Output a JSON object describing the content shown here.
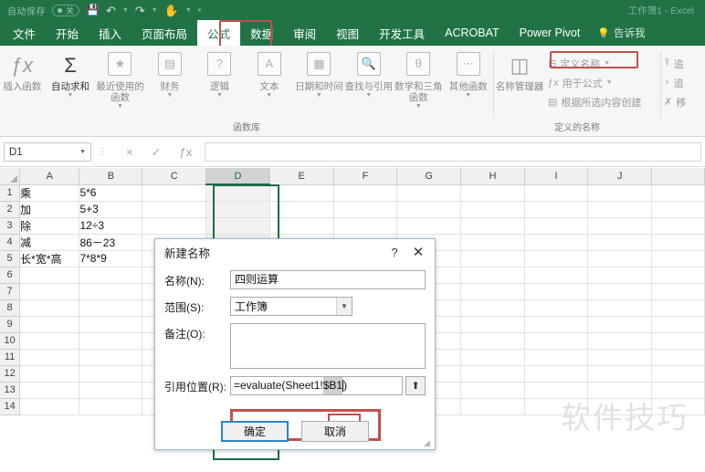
{
  "titlebar": {
    "autosave_label": "自动保存",
    "autosave_state": "关",
    "save_icon": "save-icon",
    "undo_icon": "undo-icon",
    "redo_icon": "redo-icon",
    "touch_icon": "touch-mode-icon",
    "customize_icon": "customize-qat-icon",
    "document_title": "工作簿1  -  Excel"
  },
  "tabs": [
    {
      "label": "文件",
      "active": false
    },
    {
      "label": "开始",
      "active": false
    },
    {
      "label": "插入",
      "active": false
    },
    {
      "label": "页面布局",
      "active": false
    },
    {
      "label": "公式",
      "active": true
    },
    {
      "label": "数据",
      "active": false
    },
    {
      "label": "审阅",
      "active": false
    },
    {
      "label": "视图",
      "active": false
    },
    {
      "label": "开发工具",
      "active": false
    },
    {
      "label": "ACROBAT",
      "active": false
    },
    {
      "label": "Power Pivot",
      "active": false
    }
  ],
  "tellme": {
    "icon": "lightbulb-icon",
    "label": "告诉我"
  },
  "ribbon": {
    "groups": [
      {
        "label": "函数库",
        "buttons": [
          {
            "glyph": "ƒx",
            "label": "插入函数",
            "dark": false,
            "caret": false,
            "name": "insert-function-button"
          },
          {
            "glyph": "Σ",
            "label": "自动求和",
            "dark": true,
            "caret": true,
            "name": "autosum-button"
          },
          {
            "glyph": "★",
            "label": "最近使用的函数",
            "dark": false,
            "caret": true,
            "name": "recently-used-button"
          },
          {
            "glyph": "☷",
            "label": "财务",
            "dark": false,
            "caret": true,
            "name": "financial-button"
          },
          {
            "glyph": "?",
            "label": "逻辑",
            "dark": false,
            "caret": true,
            "name": "logical-button"
          },
          {
            "glyph": "A",
            "label": "文本",
            "dark": false,
            "caret": true,
            "name": "text-button"
          },
          {
            "glyph": "▦",
            "label": "日期和时间",
            "dark": false,
            "caret": true,
            "name": "date-time-button"
          },
          {
            "glyph": "◎",
            "label": "查找与引用",
            "dark": false,
            "caret": true,
            "name": "lookup-reference-button"
          },
          {
            "glyph": "θ",
            "label": "数学和三角函数",
            "dark": false,
            "caret": true,
            "name": "math-trig-button"
          },
          {
            "glyph": "⋯",
            "label": "其他函数",
            "dark": false,
            "caret": true,
            "name": "more-functions-button"
          }
        ]
      },
      {
        "label": "定义的名称",
        "big": {
          "glyph": "☰",
          "label": "名称管理器",
          "name": "name-manager-button"
        },
        "small": [
          {
            "icon": "⊟",
            "label": "定义名称",
            "caret": true,
            "highlighted": true,
            "name": "define-name-button"
          },
          {
            "icon": "ƒx",
            "label": "用于公式",
            "caret": true,
            "highlighted": false,
            "name": "use-in-formula-button"
          },
          {
            "icon": "▤",
            "label": "根据所选内容创建",
            "caret": false,
            "highlighted": false,
            "name": "create-from-selection-button"
          }
        ]
      },
      {
        "label": "",
        "small": [
          {
            "icon": "⑂",
            "label": "追",
            "caret": false,
            "highlighted": false,
            "name": "trace-precedents-button"
          },
          {
            "icon": "⑆",
            "label": "追",
            "caret": false,
            "highlighted": false,
            "name": "trace-dependents-button"
          },
          {
            "icon": "✗",
            "label": "移",
            "caret": false,
            "highlighted": false,
            "name": "remove-arrows-button"
          }
        ]
      }
    ]
  },
  "formula_bar": {
    "name_box_value": "D1",
    "cancel_icon": "×",
    "enter_icon": "✓",
    "fx_icon": "ƒx",
    "formula_value": ""
  },
  "grid": {
    "columns": [
      "A",
      "B",
      "C",
      "D",
      "E",
      "F",
      "G",
      "H",
      "I",
      "J"
    ],
    "selected_column": "D",
    "rows": [
      {
        "num": "1",
        "A": "乘",
        "B": "5*6"
      },
      {
        "num": "2",
        "A": "加",
        "B": "5+3"
      },
      {
        "num": "3",
        "A": "除",
        "B": "12÷3"
      },
      {
        "num": "4",
        "A": "减",
        "B": "86－23"
      },
      {
        "num": "5",
        "A": "长*宽*高",
        "B": "7*8*9"
      },
      {
        "num": "6",
        "A": "",
        "B": ""
      },
      {
        "num": "7",
        "A": "",
        "B": ""
      },
      {
        "num": "8",
        "A": "",
        "B": ""
      },
      {
        "num": "9",
        "A": "",
        "B": ""
      },
      {
        "num": "10",
        "A": "",
        "B": ""
      },
      {
        "num": "11",
        "A": "",
        "B": ""
      },
      {
        "num": "12",
        "A": "",
        "B": ""
      },
      {
        "num": "13",
        "A": "",
        "B": ""
      },
      {
        "num": "14",
        "A": "",
        "B": ""
      }
    ]
  },
  "watermark": "软件技巧",
  "dialog": {
    "title": "新建名称",
    "help_icon": "?",
    "close_icon": "✕",
    "fields": {
      "name_label": "名称(N):",
      "name_value": "四则运算",
      "scope_label": "范围(S):",
      "scope_value": "工作簿",
      "comment_label": "备注(O):",
      "comment_value": "",
      "refers_label": "引用位置(R):",
      "refers_prefix": "=evaluate(Sheet1!",
      "refers_selected": "$B1",
      "refers_suffix": ")",
      "collapse_icon": "⬆"
    },
    "ok_label": "确定",
    "cancel_label": "取消"
  },
  "colors": {
    "excel_green": "#217346",
    "highlight_red": "#c0504d",
    "focus_blue": "#2e86c1"
  }
}
